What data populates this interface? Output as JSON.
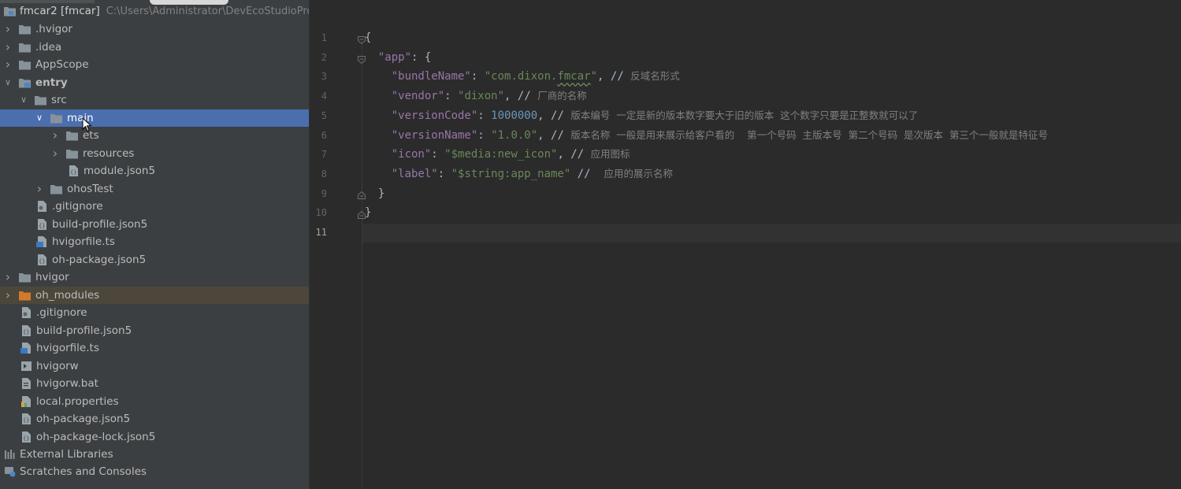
{
  "project": {
    "root_label": "fmcar2 [fmcar]",
    "root_path": "C:\\Users\\Administrator\\DevEcoStudioPro",
    "tree": [
      {
        "label": ".hvigor",
        "type": "folder",
        "depth": 0,
        "chevron": "right"
      },
      {
        "label": ".idea",
        "type": "folder",
        "depth": 0,
        "chevron": "right"
      },
      {
        "label": "AppScope",
        "type": "folder",
        "depth": 0,
        "chevron": "right"
      },
      {
        "label": "entry",
        "type": "module-folder",
        "depth": 0,
        "chevron": "down",
        "bold": true
      },
      {
        "label": "src",
        "type": "folder",
        "depth": 1,
        "chevron": "down"
      },
      {
        "label": "main",
        "type": "folder",
        "depth": 2,
        "chevron": "down",
        "selected": true
      },
      {
        "label": "ets",
        "type": "folder",
        "depth": 3,
        "chevron": "right"
      },
      {
        "label": "resources",
        "type": "folder",
        "depth": 3,
        "chevron": "right"
      },
      {
        "label": "module.json5",
        "type": "json-file",
        "depth": 3,
        "chevron": "none"
      },
      {
        "label": "ohosTest",
        "type": "folder",
        "depth": 2,
        "chevron": "right"
      },
      {
        "label": ".gitignore",
        "type": "file",
        "depth": 1,
        "chevron": "none"
      },
      {
        "label": "build-profile.json5",
        "type": "json-file",
        "depth": 1,
        "chevron": "none"
      },
      {
        "label": "hvigorfile.ts",
        "type": "ts-file",
        "depth": 1,
        "chevron": "none"
      },
      {
        "label": "oh-package.json5",
        "type": "json-file",
        "depth": 1,
        "chevron": "none"
      },
      {
        "label": "hvigor",
        "type": "folder",
        "depth": 0,
        "chevron": "right"
      },
      {
        "label": "oh_modules",
        "type": "excluded-folder",
        "depth": 0,
        "chevron": "right",
        "excluded": true
      },
      {
        "label": ".gitignore",
        "type": "file",
        "depth": 0,
        "chevron": "none"
      },
      {
        "label": "build-profile.json5",
        "type": "json-file",
        "depth": 0,
        "chevron": "none"
      },
      {
        "label": "hvigorfile.ts",
        "type": "ts-file",
        "depth": 0,
        "chevron": "none"
      },
      {
        "label": "hvigorw",
        "type": "script-file",
        "depth": 0,
        "chevron": "none"
      },
      {
        "label": "hvigorw.bat",
        "type": "bat-file",
        "depth": 0,
        "chevron": "none"
      },
      {
        "label": "local.properties",
        "type": "properties-file",
        "depth": 0,
        "chevron": "none"
      },
      {
        "label": "oh-package.json5",
        "type": "json-file",
        "depth": 0,
        "chevron": "none"
      },
      {
        "label": "oh-package-lock.json5",
        "type": "json-file",
        "depth": 0,
        "chevron": "none"
      }
    ],
    "external_libraries": "External Libraries",
    "scratches": "Scratches and Consoles"
  },
  "editor": {
    "current_line": 11,
    "line_numbers": [
      "1",
      "2",
      "3",
      "4",
      "5",
      "6",
      "7",
      "8",
      "9",
      "10",
      "11"
    ],
    "lines": [
      [
        {
          "t": "p",
          "v": "{"
        }
      ],
      [
        {
          "t": "p",
          "v": "  "
        },
        {
          "t": "k",
          "v": "\"app\""
        },
        {
          "t": "p",
          "v": ": {"
        }
      ],
      [
        {
          "t": "p",
          "v": "    "
        },
        {
          "t": "k",
          "v": "\"bundleName\""
        },
        {
          "t": "p",
          "v": ": "
        },
        {
          "t": "s",
          "v": "\"com.dixon."
        },
        {
          "t": "su",
          "v": "fmcar"
        },
        {
          "t": "s",
          "v": "\""
        },
        {
          "t": "p",
          "v": ", // "
        },
        {
          "t": "c",
          "v": "反域名形式"
        }
      ],
      [
        {
          "t": "p",
          "v": "    "
        },
        {
          "t": "k",
          "v": "\"vendor\""
        },
        {
          "t": "p",
          "v": ": "
        },
        {
          "t": "s",
          "v": "\"dixon\""
        },
        {
          "t": "p",
          "v": ", // "
        },
        {
          "t": "c",
          "v": "厂商的名称"
        }
      ],
      [
        {
          "t": "p",
          "v": "    "
        },
        {
          "t": "k",
          "v": "\"versionCode\""
        },
        {
          "t": "p",
          "v": ": "
        },
        {
          "t": "n",
          "v": "1000000"
        },
        {
          "t": "p",
          "v": ", // "
        },
        {
          "t": "c",
          "v": "版本编号  一定是新的版本数字要大于旧的版本  这个数字只要是正整数就可以了"
        }
      ],
      [
        {
          "t": "p",
          "v": "    "
        },
        {
          "t": "k",
          "v": "\"versionName\""
        },
        {
          "t": "p",
          "v": ": "
        },
        {
          "t": "s",
          "v": "\"1.0.0\""
        },
        {
          "t": "p",
          "v": ", // "
        },
        {
          "t": "c",
          "v": "版本名称  一般是用来展示给客户看的    第一个号码  主版本号  第二个号码  是次版本  第三个一般就是特征号"
        }
      ],
      [
        {
          "t": "p",
          "v": "    "
        },
        {
          "t": "k",
          "v": "\"icon\""
        },
        {
          "t": "p",
          "v": ": "
        },
        {
          "t": "s",
          "v": "\"$media:new_icon\""
        },
        {
          "t": "p",
          "v": ", // "
        },
        {
          "t": "c",
          "v": "应用图标"
        }
      ],
      [
        {
          "t": "p",
          "v": "    "
        },
        {
          "t": "k",
          "v": "\"label\""
        },
        {
          "t": "p",
          "v": ": "
        },
        {
          "t": "s",
          "v": "\"$string:app_name\""
        },
        {
          "t": "p",
          "v": " //  "
        },
        {
          "t": "c",
          "v": "应用的展示名称"
        }
      ],
      [
        {
          "t": "p",
          "v": "  }"
        }
      ],
      [
        {
          "t": "p",
          "v": "}"
        }
      ],
      []
    ]
  },
  "colors": {
    "sidebar_bg": "#3c3f41",
    "editor_bg": "#2b2b2b",
    "selection": "#4b6eaf",
    "key": "#9876aa",
    "string": "#6a8759",
    "number": "#6897bb",
    "comment": "#808080"
  }
}
